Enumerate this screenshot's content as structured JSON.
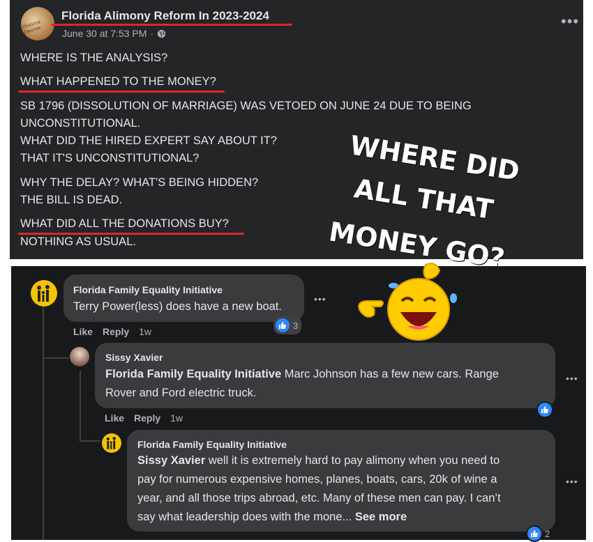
{
  "post": {
    "page_name": "Florida Alimony Reform In 2023-2024",
    "avatar_label": "Divorce Decree",
    "timestamp": "June 30 at 7:53 PM",
    "separator": "·",
    "lines": [
      "WHERE IS THE ANALYSIS?",
      "WHAT HAPPENED TO THE MONEY?",
      "SB 1796 (DISSOLUTION OF MARRIAGE) WAS VETOED ON JUNE 24 DUE TO BEING",
      "UNCONSTITUTIONAL.",
      "WHAT DID THE HIRED EXPERT SAY ABOUT IT?",
      "THAT IT'S UNCONSTITUTIONAL?",
      "WHY THE DELAY? WHAT'S BEING HIDDEN?",
      "THE BILL IS DEAD.",
      "WHAT DID ALL THE DONATIONS BUY?",
      "NOTHING AS USUAL."
    ],
    "callout": [
      "WHERE DID",
      "ALL THAT",
      "MONEY GO?"
    ],
    "more_icon": "more-horizontal-icon",
    "privacy_icon": "globe-icon"
  },
  "comments": [
    {
      "author": "Florida Family Equality Initiative",
      "text": "Terry Power(less) does have a new boat.",
      "like_label": "Like",
      "reply_label": "Reply",
      "time": "1w",
      "reactions": "3"
    },
    {
      "author": "Sissy Xavier",
      "mention": "Florida Family Equality Initiative",
      "text_line1": " Marc Johnson has a few new cars. Range",
      "text_line2": "Rover and Ford electric truck.",
      "like_label": "Like",
      "reply_label": "Reply",
      "time": "1w"
    },
    {
      "author": "Florida Family Equality Initiative",
      "mention": "Sissy Xavier",
      "text_line1": " well it is extremely hard to pay alimony when you need to",
      "text_line2": "pay for numerous expensive homes, planes, boats, cars, 20k of wine a",
      "text_line3": "year, and all those trips abroad, etc. Many of these men can pay. I can’t",
      "text_line4": "say what leadership does with the mone...",
      "see_more": "See more",
      "reactions": "2"
    }
  ],
  "colors": {
    "post_bg": "#242526",
    "comments_bg": "#18191a",
    "bubble_bg": "#3a3b3c",
    "text": "#e4e6eb",
    "muted": "#b0b3b8",
    "underline_red": "#e0262b",
    "like_blue": "#2d88ff"
  }
}
